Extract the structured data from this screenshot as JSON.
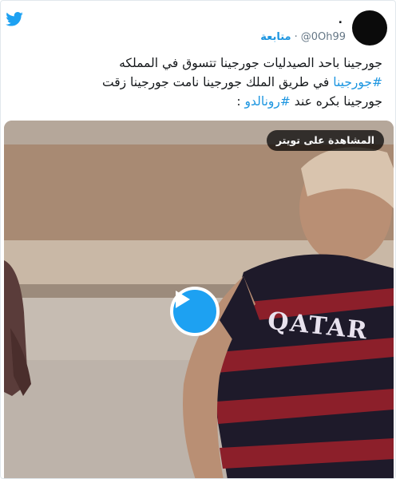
{
  "header": {
    "twitter_icon": "twitter-bird-icon",
    "avatar_dot": ".",
    "handle": "@0Oh99",
    "separator": "·",
    "follow_label": "متابعة",
    "brand_color": "#1da1f2"
  },
  "tweet": {
    "line1": "جورجينا باحد الصيدليات جورجينا تتسوق في المملكه",
    "line2_hashtag": "#جورجينا",
    "line2_text": " في طريق الملك جورجينا نامت جورجينا زقت",
    "line3_text": "جورجينا بكره عند ",
    "line3_hashtag": "#رونالدو",
    "line3_end": " :"
  },
  "media": {
    "watch_label": "المشاهدة على تويتر",
    "play_icon": "play-icon",
    "jersey_text": "QATAR"
  }
}
